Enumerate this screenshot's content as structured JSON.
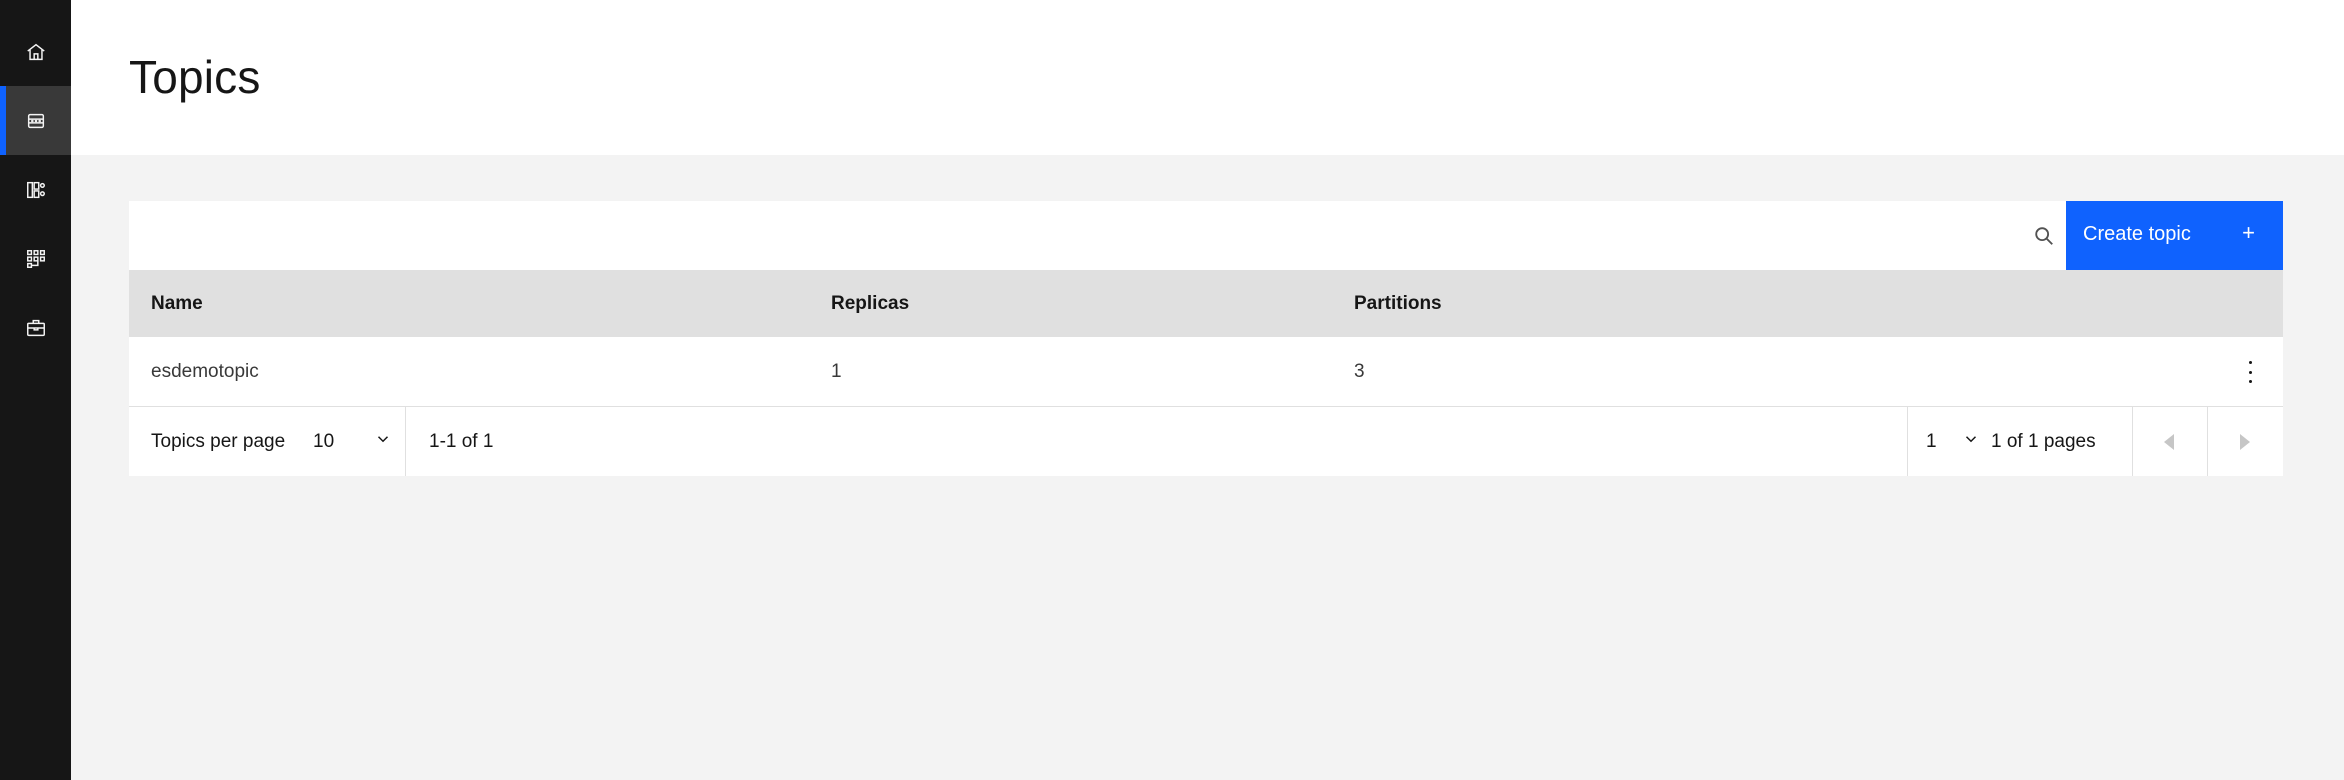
{
  "page": {
    "title": "Topics"
  },
  "sidebar": {
    "items": [
      {
        "icon": "home-icon",
        "active": false
      },
      {
        "icon": "topics-icon",
        "active": true
      },
      {
        "icon": "consumer-groups-icon",
        "active": false
      },
      {
        "icon": "schema-registry-icon",
        "active": false
      },
      {
        "icon": "toolbox-icon",
        "active": false
      }
    ]
  },
  "toolbar": {
    "search_icon": "search-icon",
    "create_label": "Create topic",
    "create_icon": "+"
  },
  "table": {
    "headers": {
      "name": "Name",
      "replicas": "Replicas",
      "partitions": "Partitions"
    },
    "rows": [
      {
        "name": "esdemotopic",
        "replicas": "1",
        "partitions": "3"
      }
    ]
  },
  "pagination": {
    "per_page_label": "Topics per page",
    "per_page_value": "10",
    "range_text": "1-1 of 1",
    "page_value": "1",
    "pages_text": "1 of 1 pages"
  },
  "colors": {
    "accent": "#0f62fe",
    "sidebar_bg": "#161616",
    "header_row_bg": "#e0e0e0",
    "page_bg": "#f3f3f3"
  }
}
